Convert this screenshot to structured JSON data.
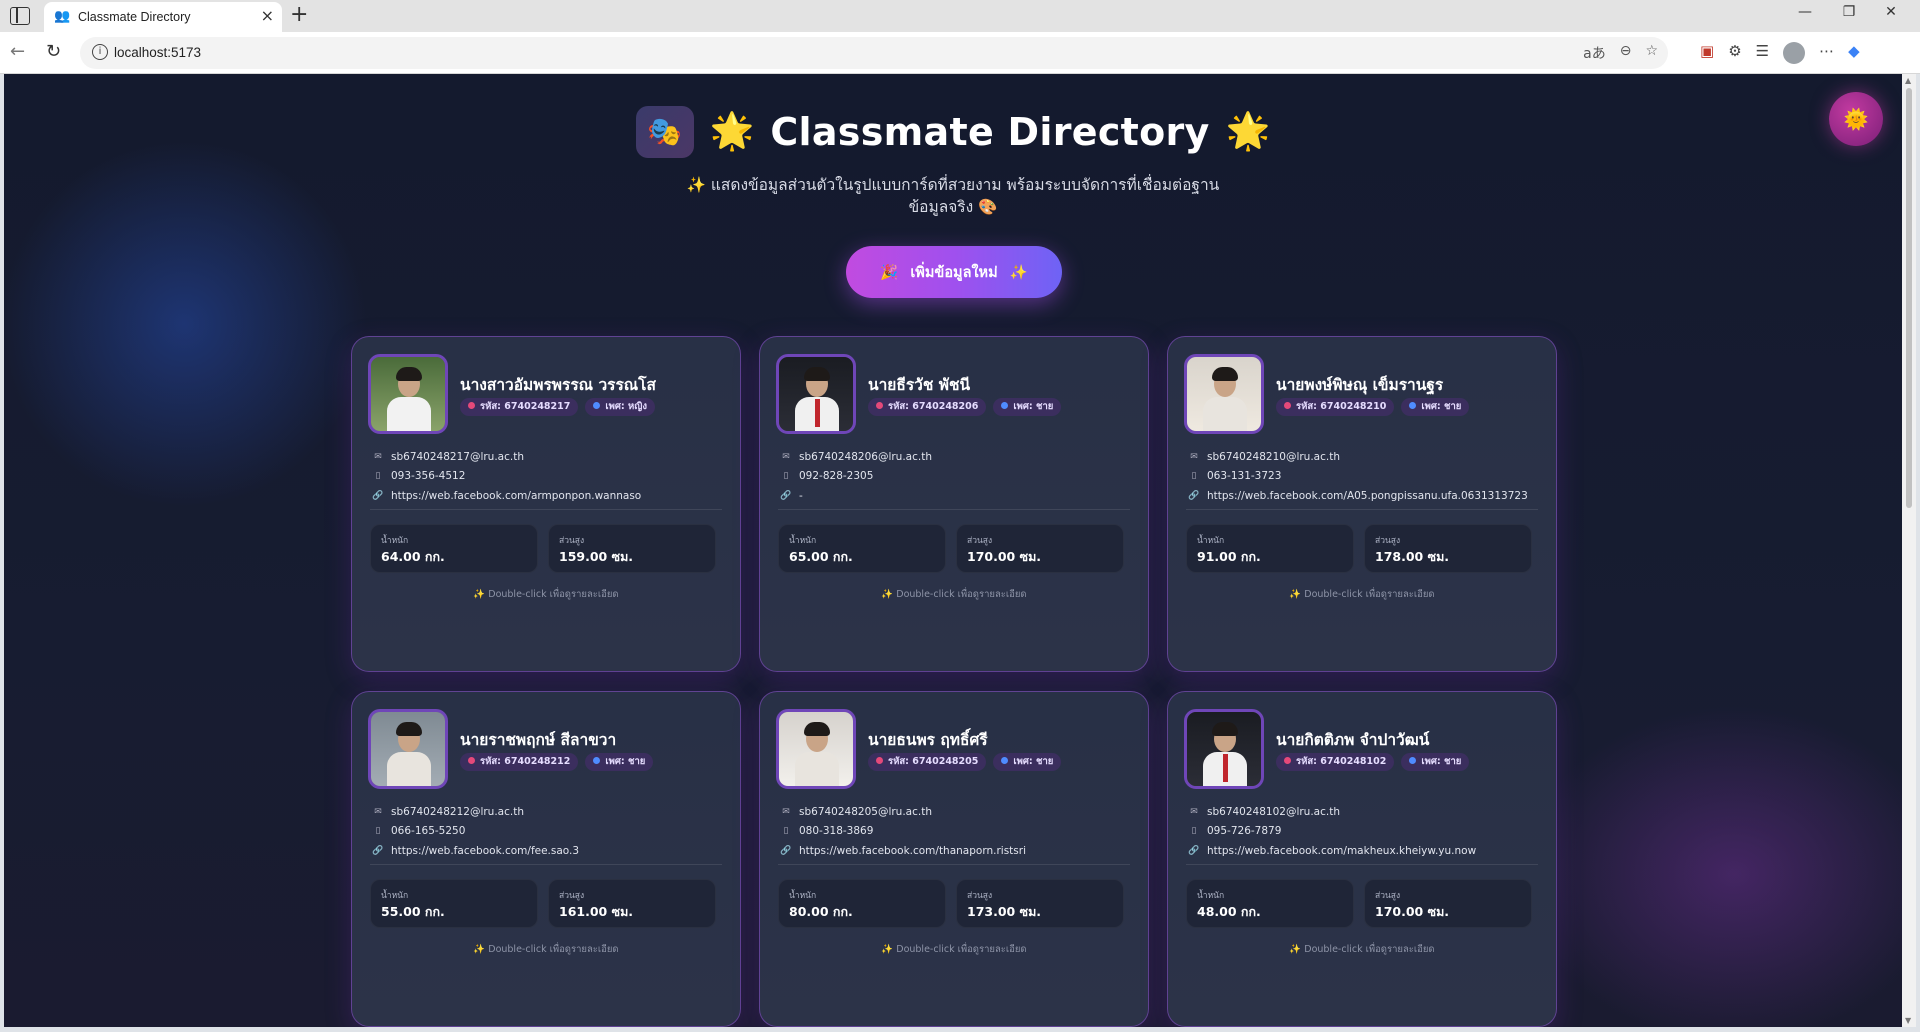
{
  "browser": {
    "tab_title": "Classmate Directory",
    "url": "localhost:5173",
    "font_size_indicator": "aあ"
  },
  "header": {
    "title_icon": "🎭",
    "sun_emoji": "🌟",
    "title": "Classmate Directory",
    "subtitle": "✨ แสดงข้อมูลส่วนตัวในรูปแบบการ์ดที่สวยงาม พร้อมระบบจัดการที่เชื่อมต่อฐานข้อมูลจริง 🎨",
    "theme_toggle_icon": "🌞"
  },
  "add_button": {
    "left_icon": "🎉",
    "label": "เพิ่มข้อมูลใหม่",
    "right_icon": "✨"
  },
  "labels": {
    "weight": "น้ำหนัก",
    "height": "ส่วนสูง",
    "hint": "✨ Double-click เพื่อดูรายละเอียด"
  },
  "cards": [
    {
      "name": "นางสาวอัมพรพรรณ วรรณโส",
      "id_badge": "รหัส: 6740248217",
      "gender_badge": "เพศ: หญิง",
      "email": "sb6740248217@lru.ac.th",
      "phone": "093-356-4512",
      "facebook": "https://web.facebook.com/armponpon.wannaso",
      "weight": "64.00 กก.",
      "height": "159.00 ซม.",
      "photo": "female-outdoor",
      "photo_colors": [
        "#4a6b3a",
        "#8aa36a"
      ]
    },
    {
      "name": "นายธีรวัช พัชนี",
      "id_badge": "รหัส: 6740248206",
      "gender_badge": "เพศ: ชาย",
      "email": "sb6740248206@lru.ac.th",
      "phone": "092-828-2305",
      "facebook": "-",
      "weight": "65.00 กก.",
      "height": "170.00 ซม.",
      "photo": "male-formal-dark",
      "photo_colors": [
        "#1a1c22",
        "#2b2d36"
      ]
    },
    {
      "name": "นายพงษ์พิษณุ เข็มรานฐร",
      "id_badge": "รหัส: 6740248210",
      "gender_badge": "เพศ: ชาย",
      "email": "sb6740248210@lru.ac.th",
      "phone": "063-131-3723",
      "facebook": "https://web.facebook.com/A05.pongpissanu.ufa.0631313723",
      "weight": "91.00 กก.",
      "height": "178.00 ซม.",
      "photo": "male-light-bg",
      "photo_colors": [
        "#d9d4cc",
        "#efe9e0"
      ]
    },
    {
      "name": "นายราชพฤกษ์ สีลาขวา",
      "id_badge": "รหัส: 6740248212",
      "gender_badge": "เพศ: ชาย",
      "email": "sb6740248212@lru.ac.th",
      "phone": "066-165-5250",
      "facebook": "https://web.facebook.com/fee.sao.3",
      "weight": "55.00 กก.",
      "height": "161.00 ซม.",
      "photo": "male-selfie",
      "photo_colors": [
        "#7f8a93",
        "#a3acb4"
      ]
    },
    {
      "name": "นายธนพร ฤทธิ์ศรี",
      "id_badge": "รหัส: 6740248205",
      "gender_badge": "เพศ: ชาย",
      "email": "sb6740248205@lru.ac.th",
      "phone": "080-318-3869",
      "facebook": "https://web.facebook.com/thanaporn.ristsri",
      "weight": "80.00 กก.",
      "height": "173.00 ซม.",
      "photo": "male-closeup",
      "photo_colors": [
        "#d6d2cd",
        "#f2f0ec"
      ]
    },
    {
      "name": "นายกิตติภพ จำปาวัฒน์",
      "id_badge": "รหัส: 6740248102",
      "gender_badge": "เพศ: ชาย",
      "email": "sb6740248102@lru.ac.th",
      "phone": "095-726-7879",
      "facebook": "https://web.facebook.com/makheux.kheiyw.yu.now",
      "weight": "48.00 กก.",
      "height": "170.00 ซม.",
      "photo": "male-formal-dark",
      "photo_colors": [
        "#1a1c22",
        "#2b2d36"
      ]
    }
  ],
  "colors": {
    "accent_purple": "#a050ee",
    "accent_pink": "#c14be0",
    "accent_blue": "#6e63f5",
    "card_border": "#8c50d2",
    "page_bg": "#161b2f"
  }
}
